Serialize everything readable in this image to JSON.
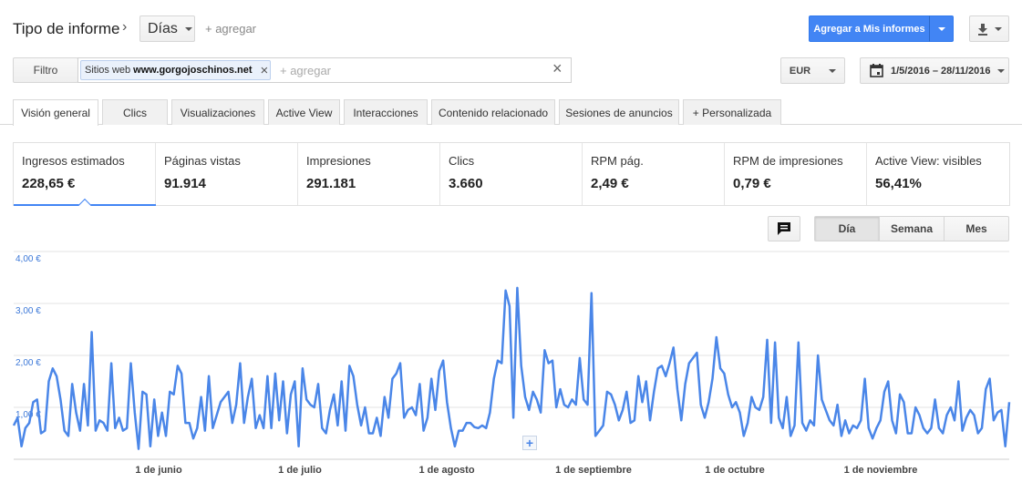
{
  "header": {
    "report_type_label": "Tipo de informe",
    "report_type_value": "Días",
    "add_link": "+ agregar",
    "add_to_reports": "Agregar a Mis informes"
  },
  "filter_bar": {
    "filter_label": "Filtro",
    "chip_prefix": "Sitios web",
    "chip_value": "www.gorgojoschinos.net",
    "add_placeholder": "+ agregar",
    "currency": "EUR",
    "date_range": "1/5/2016 – 28/11/2016"
  },
  "tabs": [
    {
      "label": "Visión general"
    },
    {
      "label": "Clics"
    },
    {
      "label": "Visualizaciones"
    },
    {
      "label": "Active View"
    },
    {
      "label": "Interacciones"
    },
    {
      "label": "Contenido relacionado"
    },
    {
      "label": "Sesiones de anuncios"
    },
    {
      "label": "+ Personalizada"
    }
  ],
  "metrics": [
    {
      "label": "Ingresos estimados",
      "value": "228,65 €"
    },
    {
      "label": "Páginas vistas",
      "value": "91.914"
    },
    {
      "label": "Impresiones",
      "value": "291.181"
    },
    {
      "label": "Clics",
      "value": "3.660"
    },
    {
      "label": "RPM pág.",
      "value": "2,49 €"
    },
    {
      "label": "RPM de impresiones",
      "value": "0,79 €"
    },
    {
      "label": "Active View: visibles",
      "value": "56,41%"
    }
  ],
  "granularity": {
    "day": "Día",
    "week": "Semana",
    "month": "Mes"
  },
  "icons": {
    "chevron": "chevron-right-icon",
    "download": "download-icon",
    "calendar": "calendar-icon",
    "comment": "comment-icon",
    "close": "close-icon"
  },
  "colors": {
    "accent": "#4285f4",
    "line": "#4a86e8",
    "axis_label": "#3c78d8"
  },
  "chart_data": {
    "type": "line",
    "series": [
      {
        "values": [
          0.65,
          0.8,
          0.25,
          0.6,
          0.7,
          1.1,
          1.15,
          0.5,
          0.55,
          1.5,
          1.75,
          1.6,
          1.15,
          0.55,
          0.45,
          1.45,
          0.9,
          0.55,
          1.45,
          0.65,
          2.45,
          0.55,
          0.75,
          0.7,
          0.55,
          1.85,
          0.6,
          0.8,
          0.55,
          0.6,
          1.85,
          0.9,
          0.2,
          1.3,
          1.25,
          0.25,
          1.15,
          0.45,
          0.9,
          0.45,
          1.3,
          1.25,
          1.8,
          1.65,
          0.7,
          0.7,
          0.4,
          0.6,
          1.2,
          0.55,
          1.6,
          0.6,
          0.85,
          1.1,
          1.2,
          1.3,
          0.7,
          1.05,
          1.85,
          0.7,
          1.2,
          1.55,
          0.6,
          0.85,
          0.6,
          1.6,
          0.6,
          1.65,
          0.75,
          1.5,
          0.5,
          1.25,
          1.5,
          0.25,
          1.75,
          1.15,
          1.05,
          1.0,
          1.45,
          0.6,
          0.5,
          0.95,
          1.25,
          0.65,
          1.5,
          0.55,
          1.8,
          1.6,
          1.05,
          0.65,
          1.0,
          0.5,
          0.5,
          0.8,
          0.45,
          1.2,
          0.8,
          1.55,
          1.65,
          1.85,
          0.8,
          0.95,
          1.0,
          0.85,
          1.45,
          0.55,
          0.8,
          1.55,
          0.95,
          1.7,
          1.9,
          1.1,
          0.6,
          0.25,
          0.55,
          0.55,
          0.7,
          0.7,
          0.62,
          0.6,
          0.65,
          0.6,
          0.9,
          1.55,
          1.9,
          1.85,
          3.25,
          2.95,
          0.8,
          3.3,
          1.8,
          1.2,
          0.95,
          1.3,
          1.15,
          0.9,
          2.1,
          1.85,
          1.9,
          1.0,
          1.35,
          1.05,
          1.0,
          1.15,
          1.05,
          1.95,
          1.15,
          1.05,
          3.2,
          0.45,
          0.55,
          0.65,
          1.3,
          1.25,
          1.05,
          0.75,
          0.95,
          1.3,
          0.7,
          0.75,
          1.6,
          1.1,
          1.5,
          0.75,
          1.3,
          1.75,
          1.8,
          1.6,
          1.85,
          2.15,
          1.35,
          0.75,
          1.45,
          1.85,
          1.95,
          2.05,
          1.05,
          0.8,
          1.1,
          1.55,
          2.35,
          1.75,
          1.65,
          1.25,
          1.0,
          1.1,
          0.9,
          0.45,
          0.7,
          1.2,
          1.0,
          0.95,
          1.2,
          2.3,
          0.7,
          2.25,
          0.8,
          0.6,
          1.2,
          0.45,
          0.65,
          2.25,
          0.7,
          0.55,
          0.75,
          0.65,
          2.0,
          1.15,
          0.95,
          0.75,
          0.65,
          1.05,
          0.45,
          0.75,
          0.5,
          0.65,
          0.6,
          0.75,
          1.55,
          0.6,
          0.4,
          0.6,
          0.75,
          1.3,
          1.5,
          0.75,
          0.5,
          1.25,
          1.1,
          0.5,
          0.5,
          1.0,
          0.85,
          0.6,
          0.5,
          0.6,
          1.15,
          0.6,
          0.5,
          0.85,
          1.0,
          0.75,
          1.5,
          0.55,
          0.8,
          0.95,
          0.85,
          0.5,
          0.6,
          1.35,
          1.55,
          0.75,
          0.9,
          0.95,
          0.25,
          1.1
        ]
      }
    ],
    "x_labels": [
      "1 de junio",
      "1 de julio",
      "1 de agosto",
      "1 de septiembre",
      "1 de octubre",
      "1 de noviembre"
    ],
    "x_start": "1/5/2016",
    "x_end": "28/11/2016",
    "y_ticks": [
      "1,00 €",
      "2,00 €",
      "3,00 €",
      "4,00 €"
    ],
    "ylim": [
      0,
      4.5
    ],
    "grid": true
  }
}
